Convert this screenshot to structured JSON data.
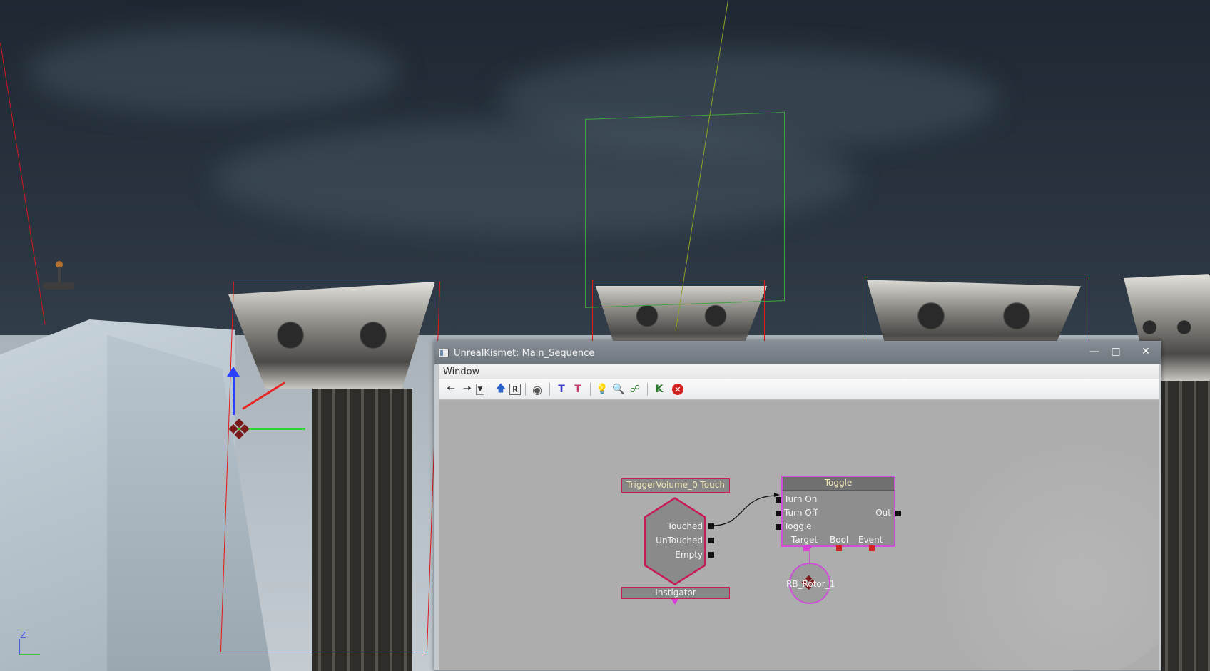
{
  "window": {
    "title": "UnrealKismet: Main_Sequence",
    "minimize_glyph": "—",
    "maximize_glyph": "□",
    "close_glyph": "✕"
  },
  "menu": {
    "items": [
      "Window"
    ]
  },
  "toolbar": {
    "icons": [
      "back-arrow-icon",
      "forward-arrow-icon",
      "dropdown-icon",
      "parent-sequence-icon",
      "rename-sequence-icon",
      "hide-connectors-icon",
      "show-connectors-icon",
      "hide-unused-icon",
      "search-icon",
      "zoom-icon",
      "link-icon",
      "kismet-k-icon",
      "stop-icon"
    ]
  },
  "event_node": {
    "title": "TriggerVolume_0 Touch",
    "outputs": [
      "Touched",
      "UnTouched",
      "Empty"
    ],
    "variable": "Instigator"
  },
  "toggle_node": {
    "title": "Toggle",
    "inputs": [
      "Turn On",
      "Turn Off",
      "Toggle"
    ],
    "output": "Out",
    "variables": [
      "Target",
      "Bool",
      "Event"
    ]
  },
  "object_var": {
    "label": "RB_Rotor_1"
  },
  "axis_indicator": {
    "z_label": "Z"
  },
  "colors": {
    "node_border": "#c71a5a",
    "toggle_border": "#cf4fd8",
    "title_text": "#f1e7b6",
    "selection_wire": "#e01919",
    "canvas": "#adadad"
  }
}
